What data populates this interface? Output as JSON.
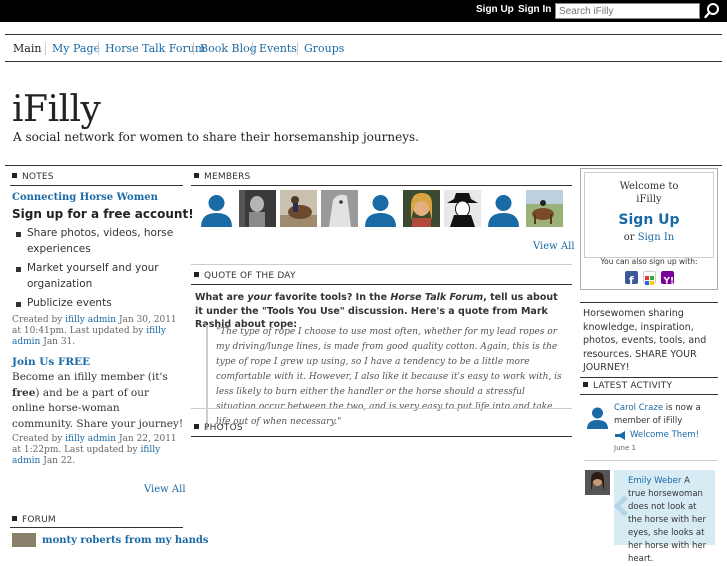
{
  "topbar": {
    "signup": "Sign Up",
    "signin": "Sign In",
    "search_placeholder": "Search iFilly"
  },
  "nav": [
    "Main",
    "My Page",
    "Horse Talk Forum",
    "Book Blog",
    "Events",
    "Groups"
  ],
  "site": {
    "title": "iFilly",
    "description": "A social network for women to share their horsemanship journeys."
  },
  "notes": {
    "heading": "NOTES",
    "title": "Connecting Horse Women",
    "signup_heading": "Sign up for a free account!",
    "bullets": [
      "Share photos, videos, horse experiences",
      "Market yourself and your organization",
      "Publicize events"
    ],
    "meta1_pre": "Created by ",
    "meta1_author": "ifilly admin",
    "meta1_mid": " Jan 30, 2011 at 10:41pm. Last updated by ",
    "meta1_updater": "ifilly admin",
    "meta1_post": " Jan 31.",
    "join_title": "Join Us FREE",
    "join_body_1": "Become an ifilly member (it's ",
    "join_body_bold": "free",
    "join_body_2": ") and be a part of our online horse-woman community. Share your journey!",
    "meta2_pre": "Created by ",
    "meta2_author": "ifilly admin",
    "meta2_mid": " Jan 22, 2011 at 1:22pm. Last updated by ",
    "meta2_updater": "ifilly admin",
    "meta2_post": " Jan 22.",
    "view_all": "View All"
  },
  "forum": {
    "heading": "FORUM",
    "item": "monty roberts from my hands"
  },
  "members": {
    "heading": "MEMBERS",
    "view_all": "View All"
  },
  "quote": {
    "heading": "QUOTE OF THE DAY",
    "intro_1": "What are ",
    "intro_your": "your",
    "intro_2": " favorite tools? In the ",
    "intro_forum": "Horse Talk Forum",
    "intro_3": ", tell us about it under the \"Tools You Use\" discussion. Here's a quote from Mark Rashid about rope:",
    "body": "\"The type of rope I choose to use most often, whether for my lead ropes or my driving/lunge lines, is made from good quality cotton. Again, this is the type of rope I grew up using, so I have a tendency to be a little more comfortable with it. However, I also like it because it's easy to work with, is less likely to burn either the handler or the horse should a stressful situation occur between the two, and is very easy to put life into and take life out of when necessary.\""
  },
  "photos": {
    "heading": "PHOTOS"
  },
  "welcome": {
    "welcome_to": "Welcome to",
    "name": "iFilly",
    "signup": "Sign Up",
    "or": "or ",
    "signin": "Sign In",
    "also": "You can also sign up with:"
  },
  "tagline": "Horsewomen sharing knowledge, inspiration, photos, events, tools, and resources. SHARE YOUR JOURNEY!",
  "activity": {
    "heading": "LATEST ACTIVITY",
    "item1_name": "Carol Craze",
    "item1_text": " is now a member of iFilly",
    "item1_action": "Welcome Them!",
    "item1_date": "June 1",
    "item2_name": "Emily Weber",
    "item2_text": " A true horsewoman does not look at the horse with her eyes, she looks at her horse with her heart."
  },
  "colors": {
    "link": "#1a6aa6",
    "topbar": "#000000",
    "bubble": "#d7ebf5"
  }
}
